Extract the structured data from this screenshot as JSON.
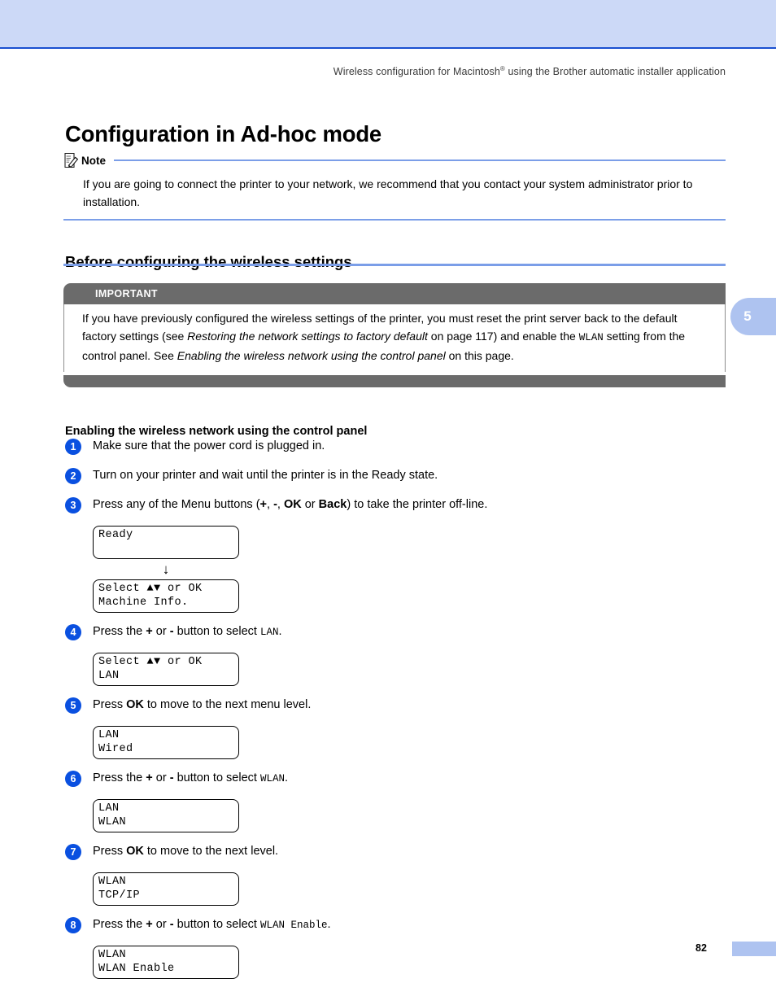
{
  "header": {
    "running_head_pre": "Wireless configuration for Macintosh",
    "running_head_sup": "®",
    "running_head_post": " using the Brother automatic installer application"
  },
  "page_title": "Configuration in Ad-hoc mode",
  "note": {
    "label": "Note",
    "body": "If you are going to connect the printer to your network, we recommend that you contact your system administrator prior to installation."
  },
  "section_heading": "Before configuring the wireless settings",
  "important": {
    "label": "IMPORTANT",
    "t1": "If you have previously configured the wireless settings of the printer, you must reset the print server back to the default factory settings (see ",
    "i1": "Restoring the network settings to factory default",
    "t2": " on page 117) and enable the ",
    "m1": "WLAN",
    "t3": " setting from the control panel. See ",
    "i2": "Enabling the wireless network using the control panel",
    "t4": " on this page."
  },
  "chapter_tab": "5",
  "sub_heading": "Enabling the wireless network using the control panel",
  "steps": [
    {
      "num": "1",
      "t1": "Make sure that the power cord is plugged in.",
      "b1": "",
      "t2": "",
      "b2": "",
      "t3": "",
      "b3": "",
      "t4": "",
      "b4": "",
      "t5": "",
      "m1": "",
      "t6": ""
    },
    {
      "num": "2",
      "t1": "Turn on your printer and wait until the printer is in the Ready state."
    },
    {
      "num": "3",
      "t1": "Press any of the Menu buttons (",
      "b1": "+",
      "t2": ", ",
      "b2": "-",
      "t3": ", ",
      "b3": "OK",
      "t4": " or ",
      "b4": "Back",
      "t5": ") to take the printer off-line."
    },
    {
      "num": "4",
      "t1": "Press the ",
      "b1": "+",
      "t2": " or ",
      "b2": "-",
      "t3": " button to select ",
      "m1": "LAN",
      "t6": "."
    },
    {
      "num": "5",
      "t1": "Press ",
      "b1": "OK",
      "t2": " to move to the next menu level."
    },
    {
      "num": "6",
      "t1": "Press the ",
      "b1": "+",
      "t2": " or ",
      "b2": "-",
      "t3": " button to select ",
      "m1": "WLAN",
      "t6": "."
    },
    {
      "num": "7",
      "t1": "Press ",
      "b1": "OK",
      "t2": " to move to the next level."
    },
    {
      "num": "8",
      "t1": "Press the ",
      "b1": "+",
      "t2": " or ",
      "b2": "-",
      "t3": " button to select ",
      "m1": "WLAN Enable",
      "t6": "."
    }
  ],
  "lcd": {
    "ready": {
      "line1": "Ready",
      "line2": ""
    },
    "arrow": "↓",
    "machine_info": {
      "line1": "Select ▲▼ or OK",
      "line2": "Machine Info."
    },
    "select_lan": {
      "line1": "Select ▲▼ or OK",
      "line2": "LAN"
    },
    "lan_wired": {
      "line1": "LAN",
      "line2": "Wired"
    },
    "lan_wlan": {
      "line1": "LAN",
      "line2": "WLAN"
    },
    "wlan_tcpip": {
      "line1": "WLAN",
      "line2": "TCP/IP"
    },
    "wlan_enable": {
      "line1": "WLAN",
      "line2": "WLAN Enable"
    }
  },
  "footer": {
    "page_number": "82"
  },
  "colors": {
    "banner": "#ccd9f7",
    "rule": "#1a50d0",
    "accent_line": "#7b9ee8",
    "important_bar": "#6b6b6b",
    "step_circle": "#0a50e0",
    "tab": "#aec3f0"
  }
}
